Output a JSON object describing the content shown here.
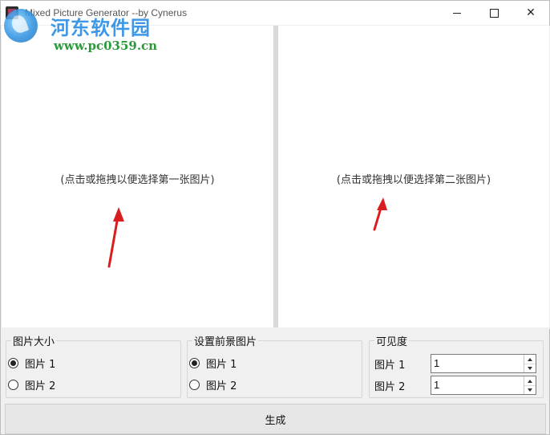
{
  "window": {
    "title": "Mixed Picture Generator     --by Cynerus",
    "controls": {
      "minimize": "minimize-icon",
      "maximize": "maximize-icon",
      "close": "close-icon"
    }
  },
  "watermark": {
    "site_name": "河东软件园",
    "url": "www.pc0359.cn"
  },
  "panels": {
    "left_hint": "(点击或拖拽以便选择第一张图片)",
    "right_hint": "(点击或拖拽以便选择第二张图片)"
  },
  "image_size_group": {
    "label": "图片大小",
    "options": [
      {
        "label": "图片 1",
        "checked": true
      },
      {
        "label": "图片 2",
        "checked": false
      }
    ]
  },
  "foreground_group": {
    "label": "设置前景图片",
    "options": [
      {
        "label": "图片 1",
        "checked": true
      },
      {
        "label": "图片 2",
        "checked": false
      }
    ]
  },
  "visibility_group": {
    "label": "可见度",
    "rows": [
      {
        "label": "图片 1",
        "value": "1"
      },
      {
        "label": "图片 2",
        "value": "1"
      }
    ]
  },
  "generate_button": {
    "label": "生成"
  },
  "colors": {
    "arrow": "#d81e1e",
    "watermark_blue": "#2f8fe6",
    "watermark_green": "#2a9a3a"
  }
}
